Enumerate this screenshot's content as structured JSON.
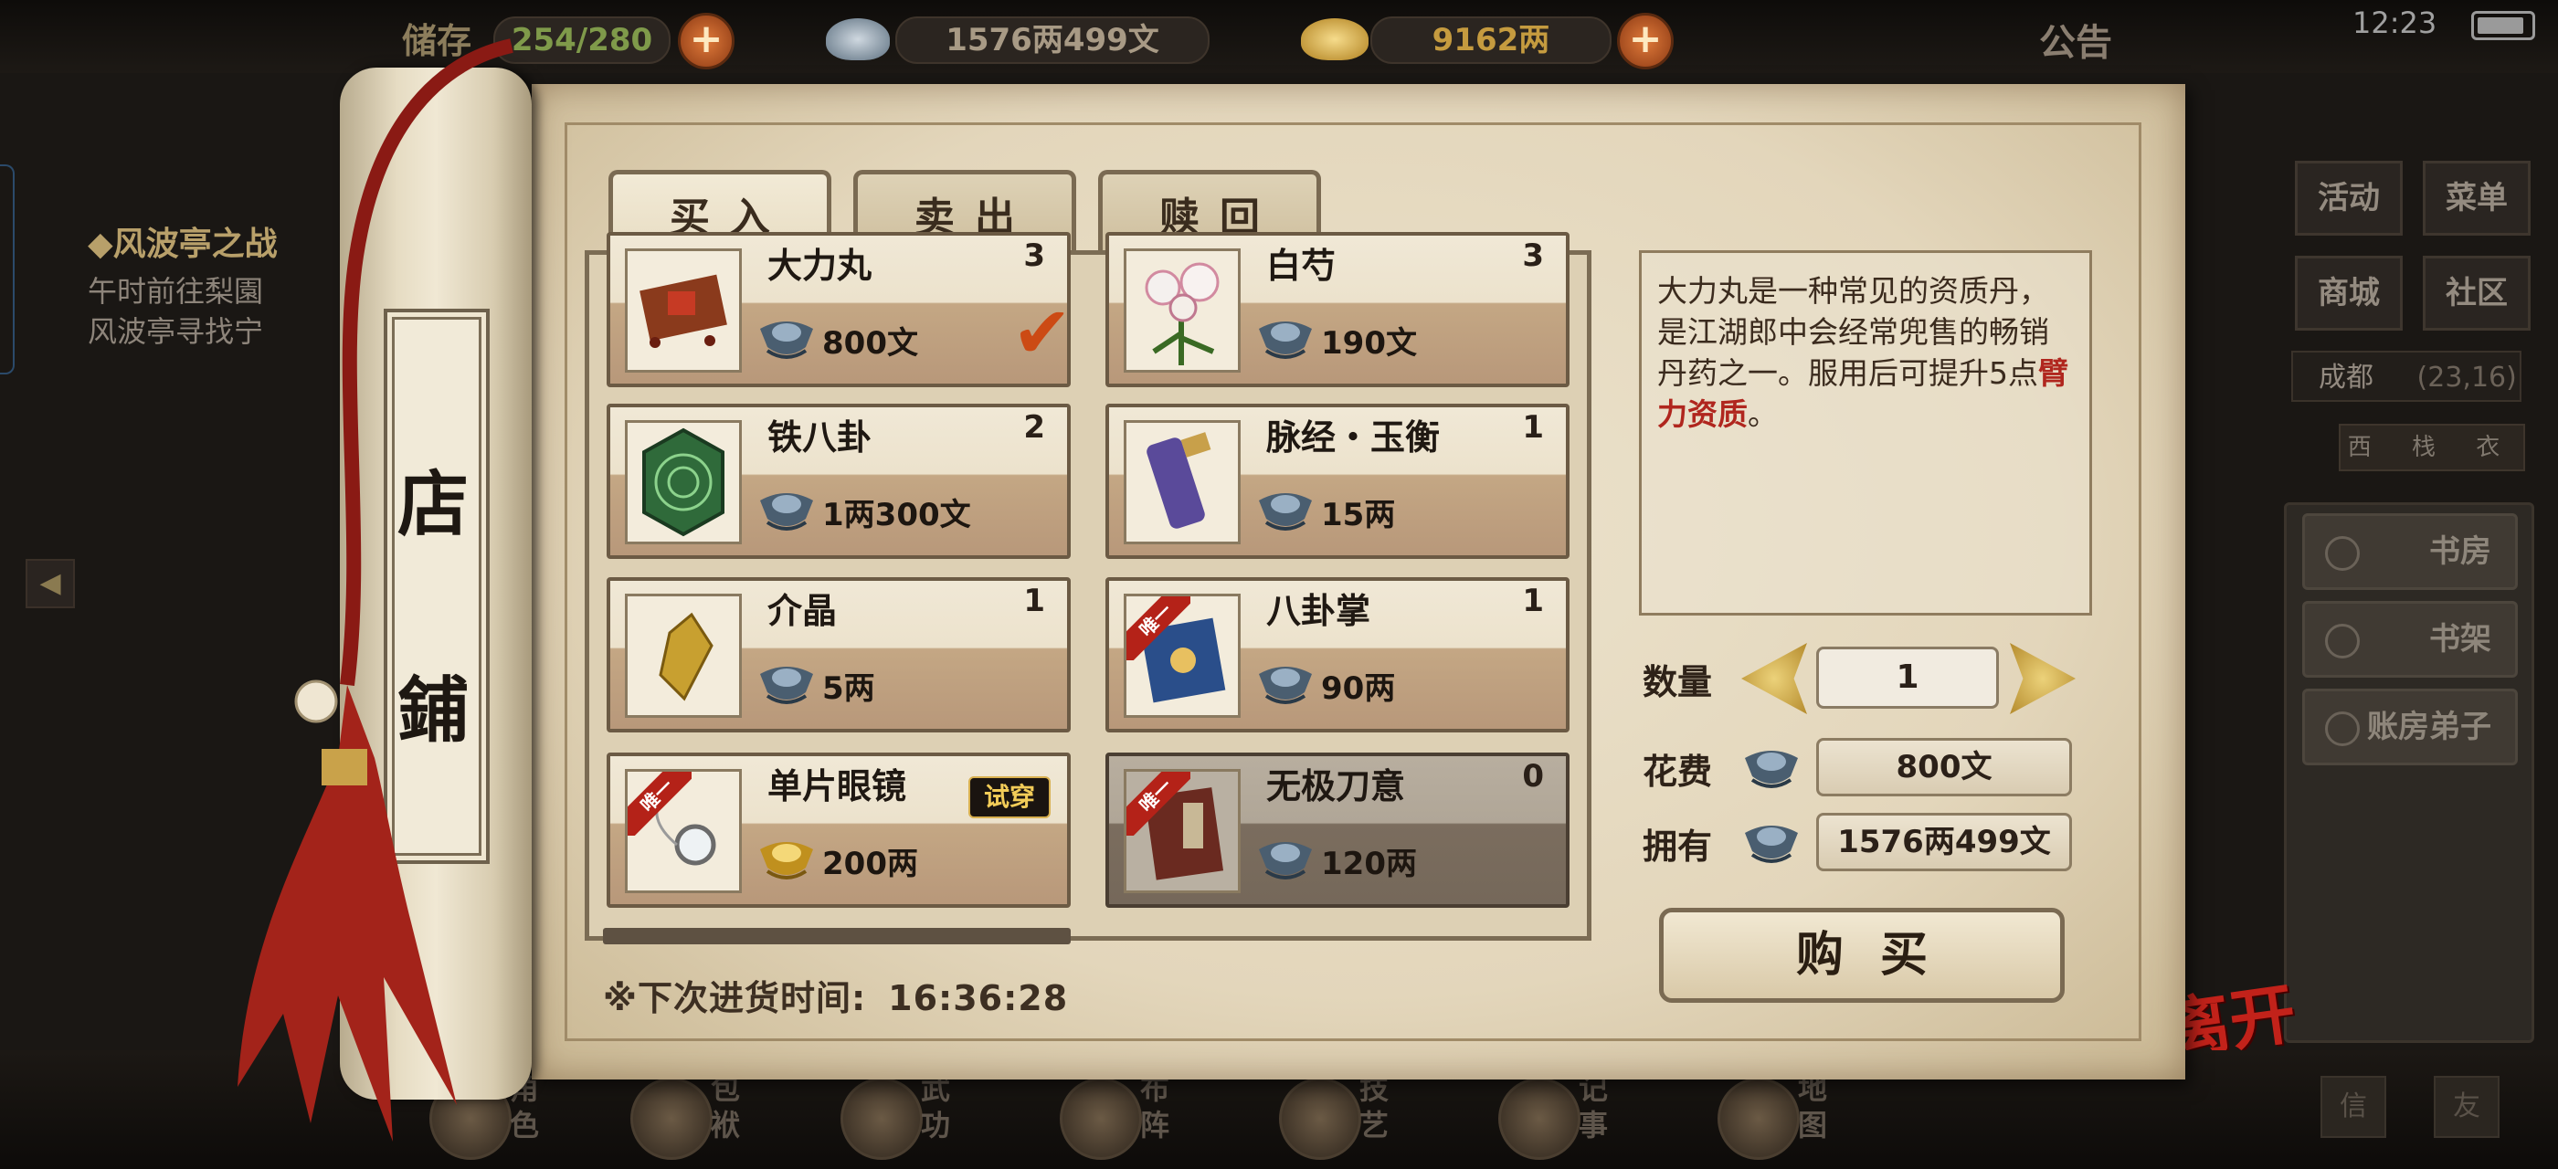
{
  "hud": {
    "stat1_label": "储存",
    "stat1_value": "254/280",
    "silver_value": "1576两499文",
    "gold_value": "9162两",
    "notice": "公告",
    "time": "12:23"
  },
  "quest": {
    "title": "◆风波亭之战",
    "line1": "午时前往梨園",
    "line2": "风波亭寻找宁"
  },
  "right_menu": {
    "activity": "活动",
    "menu": "菜单",
    "mall": "商城",
    "community": "社区",
    "location": "成都",
    "coords": "(23,16)",
    "compass": "西 栈 衣",
    "rooms": [
      "书房",
      "书架",
      "账房弟子"
    ],
    "leave": "离开"
  },
  "bottom_nav": [
    "角色",
    "包袱",
    "武功",
    "布阵",
    "技艺",
    "记事",
    "地图"
  ],
  "corner_buttons": [
    "信",
    "友"
  ],
  "shop": {
    "scroll_title_1": "店",
    "scroll_title_2": "鋪",
    "tabs": [
      "买入",
      "卖出",
      "赎回"
    ],
    "items": [
      {
        "name": "大力丸",
        "count": "3",
        "price": "800文",
        "currency": "silver",
        "selected": true,
        "unique": false,
        "try": ""
      },
      {
        "name": "白芍",
        "count": "3",
        "price": "190文",
        "currency": "silver",
        "selected": false,
        "unique": false,
        "try": ""
      },
      {
        "name": "铁八卦",
        "count": "2",
        "price": "1两300文",
        "currency": "silver",
        "selected": false,
        "unique": false,
        "try": ""
      },
      {
        "name": "脉经・玉衡",
        "count": "1",
        "price": "15两",
        "currency": "silver",
        "selected": false,
        "unique": false,
        "try": ""
      },
      {
        "name": "介晶",
        "count": "1",
        "price": "5两",
        "currency": "silver",
        "selected": false,
        "unique": false,
        "try": ""
      },
      {
        "name": "八卦掌",
        "count": "1",
        "price": "90两",
        "currency": "silver",
        "selected": false,
        "unique": true,
        "try": ""
      },
      {
        "name": "单片眼镜",
        "count": "",
        "price": "200两",
        "currency": "gold",
        "selected": false,
        "unique": true,
        "try": "试穿"
      },
      {
        "name": "无极刀意",
        "count": "0",
        "price": "120两",
        "currency": "silver",
        "selected": false,
        "unique": true,
        "try": "",
        "sold_out": true
      }
    ],
    "unique_tag": "唯一",
    "description_pre": "大力丸是一种常见的资质丹，是江湖郎中会经常兜售的畅销丹药之一。服用后可提升5点",
    "description_highlight": "臂力资质",
    "description_post": "。",
    "quantity_label": "数量",
    "quantity": "1",
    "cost_label": "花费",
    "cost": "800文",
    "own_label": "拥有",
    "own": "1576两499文",
    "buy": "购买",
    "restock_label": "※下次进货时间:",
    "restock_time": "16:36:28"
  },
  "colors": {
    "highlight_red": "#b0261e",
    "leave_red": "#c2221a",
    "plus_orange": "#e07a3a",
    "paper": "#e6dcc5"
  }
}
